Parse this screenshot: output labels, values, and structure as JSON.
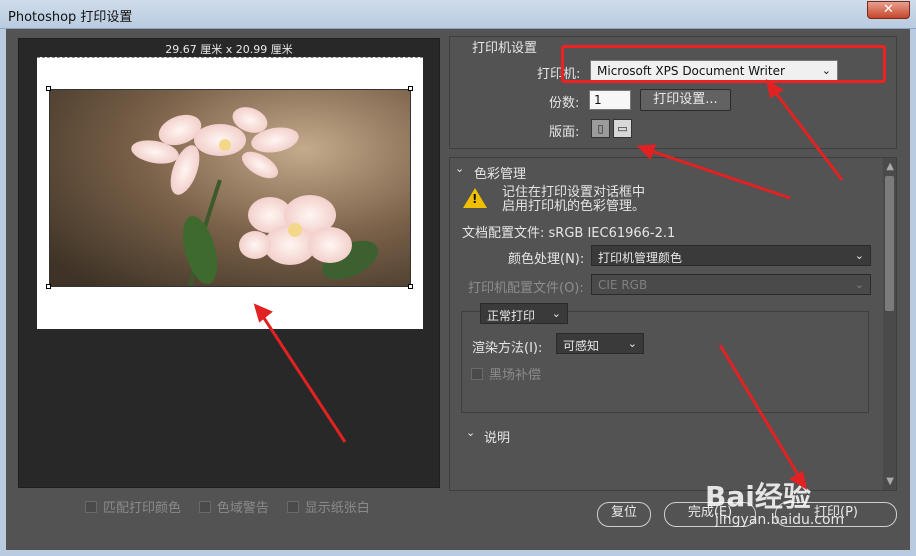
{
  "window": {
    "title": "Photoshop 打印设置",
    "close_label": "✕"
  },
  "preview": {
    "dimensions": "29.67 厘米 x 20.99 厘米"
  },
  "preview_checks": [
    {
      "label": "匹配打印颜色",
      "checked": false
    },
    {
      "label": "色域警告",
      "checked": false
    },
    {
      "label": "显示纸张白",
      "checked": false
    }
  ],
  "printer_setup": {
    "group_title": "打印机设置",
    "printer_label": "打印机:",
    "printer_value": "Microsoft XPS Document Writer",
    "copies_label": "份数:",
    "copies_value": "1",
    "print_settings_button": "打印设置...",
    "layout_label": "版面:"
  },
  "color_management": {
    "title": "色彩管理",
    "warning_line1": "记住在打印设置对话框中",
    "warning_line2": "启用打印机的色彩管理。",
    "doc_profile": "文档配置文件: sRGB IEC61966-2.1",
    "color_handling_label": "颜色处理(N):",
    "color_handling_value": "打印机管理颜色",
    "printer_profile_label": "打印机配置文件(O):",
    "printer_profile_value": "CIE RGB",
    "print_mode": "正常打印",
    "render_label": "渲染方法(I):",
    "render_value": "可感知",
    "black_point_label": "黑场补偿"
  },
  "description": {
    "title": "说明"
  },
  "buttons": {
    "reset": "复位",
    "done": "完成(E)",
    "print": "打印(P)"
  },
  "watermark": {
    "text": "Bai经验",
    "sub": "jingyan.baidu.com"
  },
  "colors": {
    "annotation": "#e22222",
    "panel": "#535353",
    "preview_bg": "#282828"
  }
}
